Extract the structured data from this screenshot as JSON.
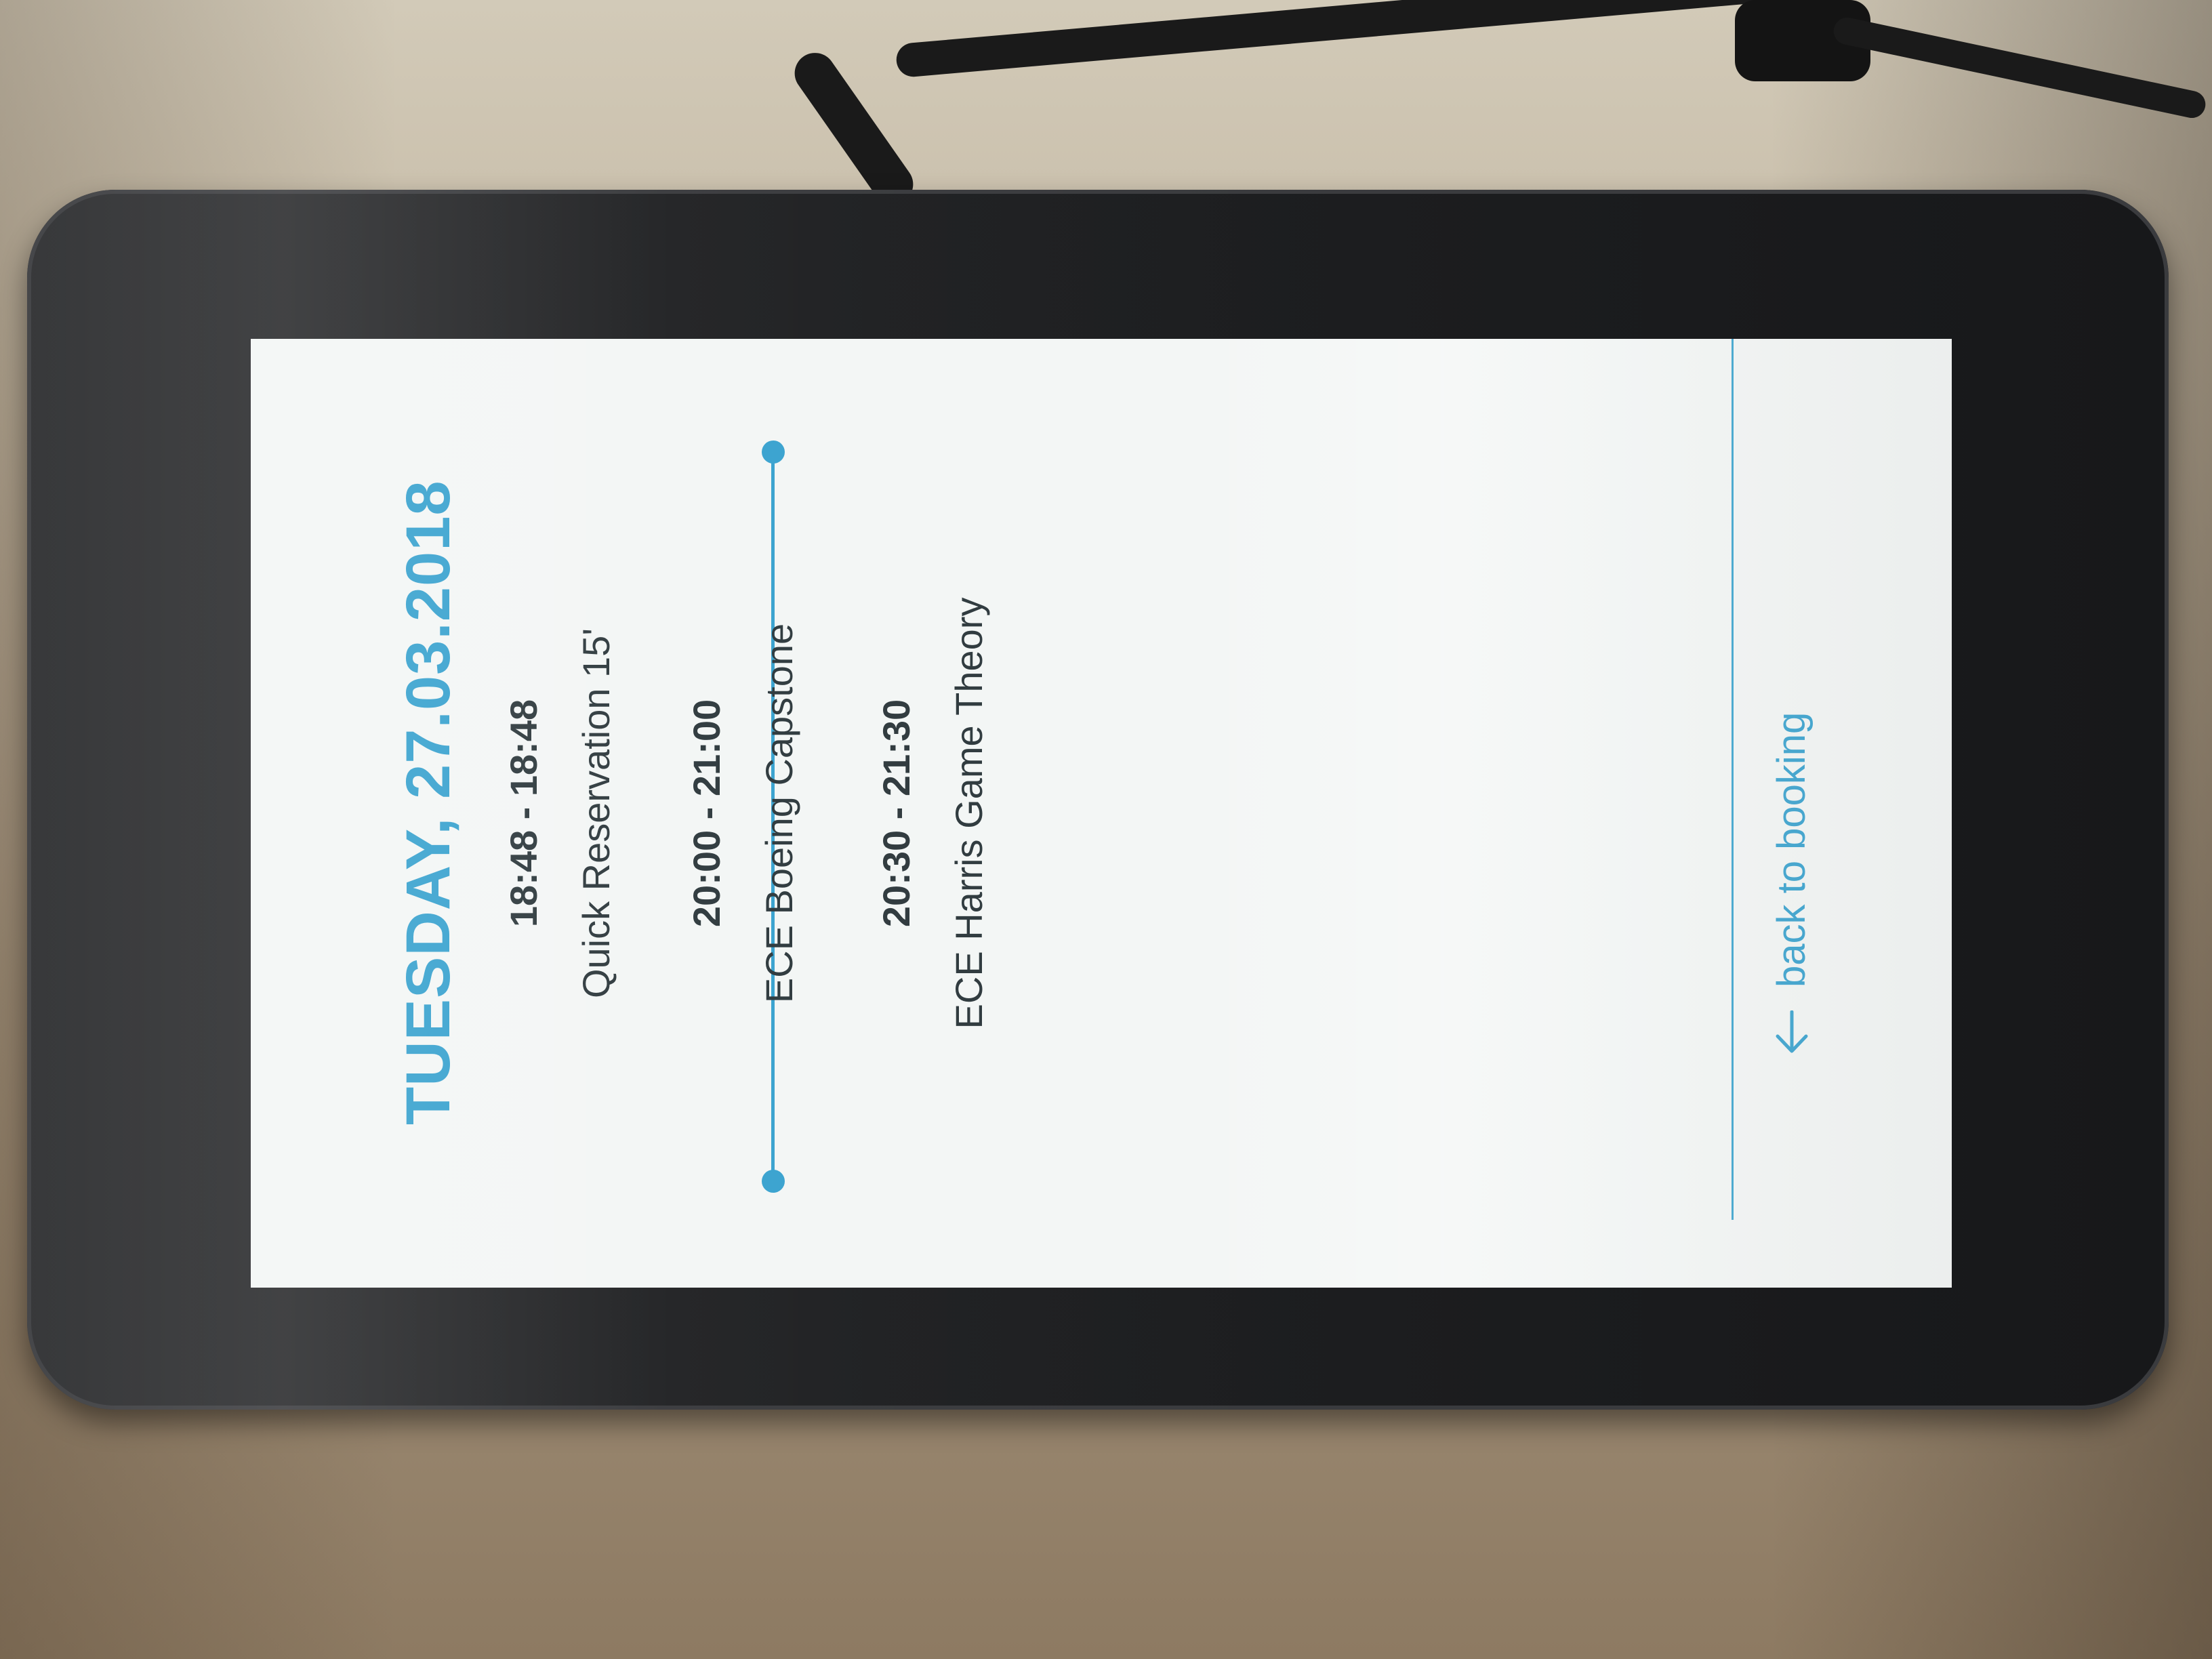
{
  "colors": {
    "accent": "#3aa3cf",
    "text": "#2f3a3e",
    "screen_background": "#f3f6f5",
    "bezel": "#1f2022"
  },
  "header": {
    "date_title": "TUESDAY, 27.03.2018"
  },
  "events": [
    {
      "time": "18:48 - 18:48",
      "title": "Quick Reservation 15'"
    },
    {
      "time": "20:00 - 21:00",
      "title": "ECE Boeing Capstone"
    },
    {
      "time": "20:30 - 21:30",
      "title": "ECE Harris Game Theory"
    }
  ],
  "footer": {
    "back_label": "back to booking",
    "back_icon": "arrow-left-icon"
  }
}
